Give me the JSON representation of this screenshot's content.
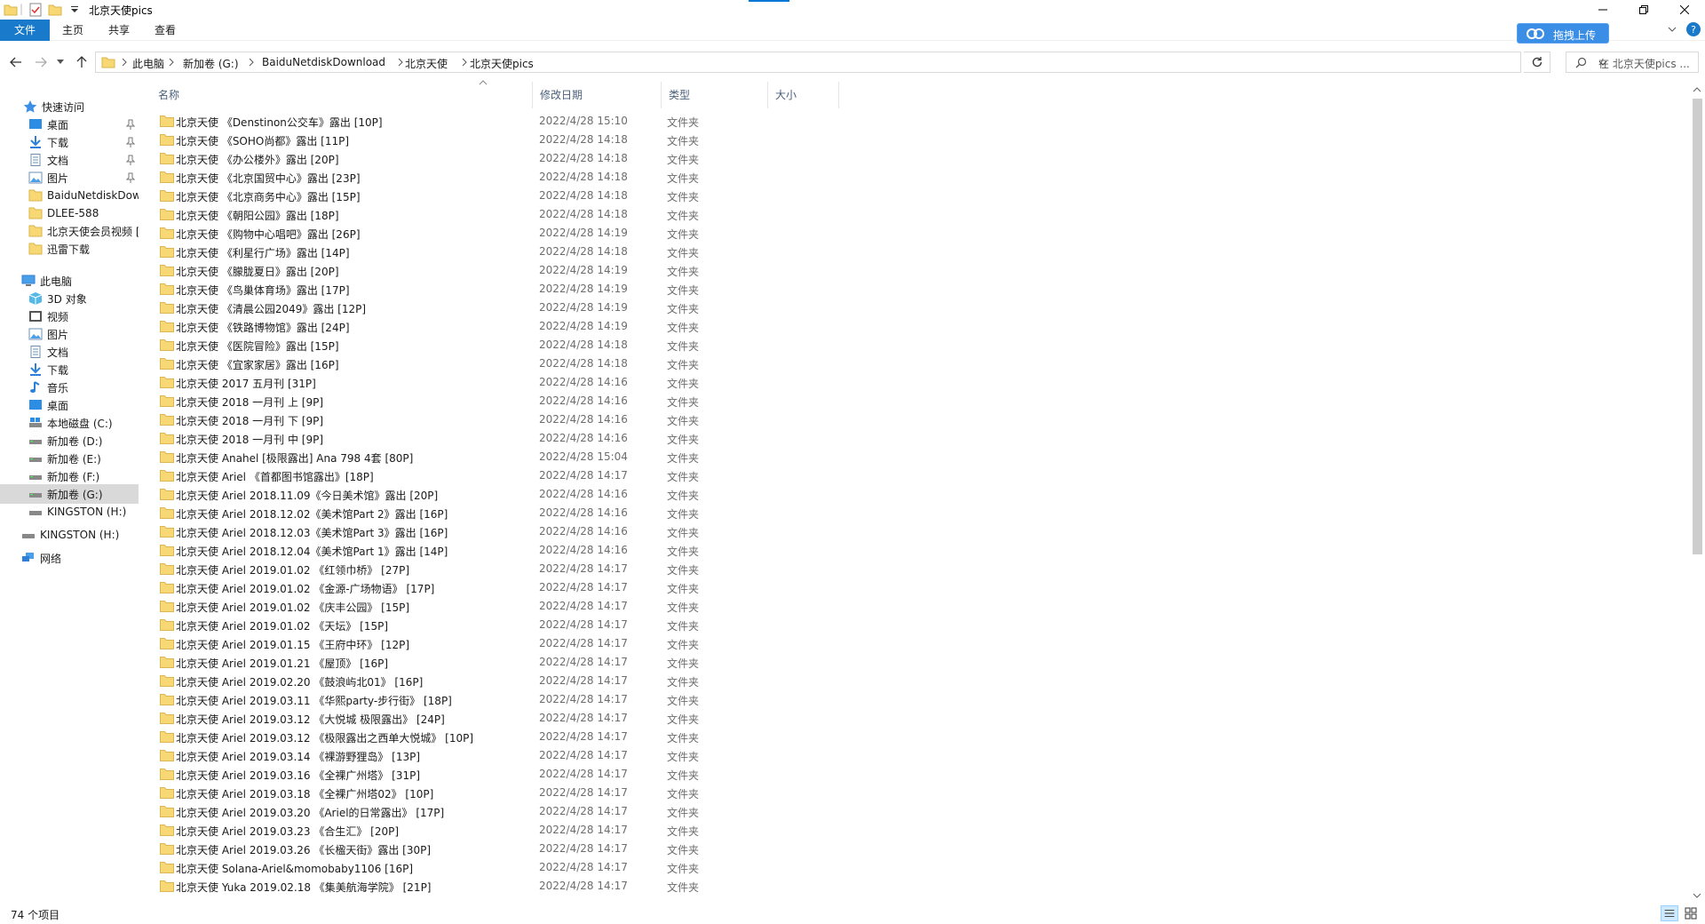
{
  "window": {
    "title": "北京天使pics"
  },
  "ribbon": {
    "tabs": [
      "文件",
      "主页",
      "共享",
      "查看"
    ],
    "upload_label": "拖拽上传"
  },
  "address": {
    "crumbs": [
      "此电脑",
      "新加卷 (G:)",
      "BaiduNetdiskDownload",
      "北京天使",
      "北京天使pics"
    ],
    "search_placeholder": "在 北京天使pics ..."
  },
  "nav": {
    "quick_access": "快速访问",
    "quick_items": [
      "桌面",
      "下载",
      "文档",
      "图片",
      "BaiduNetdiskDow",
      "DLEE-588",
      "北京天使会员视频 [",
      "迅雷下载"
    ],
    "this_pc": "此电脑",
    "pc_items": [
      "3D 对象",
      "视频",
      "图片",
      "文档",
      "下载",
      "音乐",
      "桌面",
      "本地磁盘 (C:)",
      "新加卷 (D:)",
      "新加卷 (E:)",
      "新加卷 (F:)",
      "新加卷 (G:)",
      "KINGSTON (H:)"
    ],
    "kingston": "KINGSTON (H:)",
    "network": "网络"
  },
  "columns": {
    "name": "名称",
    "date": "修改日期",
    "type": "类型",
    "size": "大小"
  },
  "files": [
    {
      "name": "北京天使 《Denstinon公交车》露出 [10P]",
      "date": "2022/4/28 15:10",
      "type": "文件夹"
    },
    {
      "name": "北京天使 《SOHO尚都》露出 [11P]",
      "date": "2022/4/28 14:18",
      "type": "文件夹"
    },
    {
      "name": "北京天使 《办公楼外》露出 [20P]",
      "date": "2022/4/28 14:18",
      "type": "文件夹"
    },
    {
      "name": "北京天使 《北京国贸中心》露出 [23P]",
      "date": "2022/4/28 14:18",
      "type": "文件夹"
    },
    {
      "name": "北京天使 《北京商务中心》露出 [15P]",
      "date": "2022/4/28 14:18",
      "type": "文件夹"
    },
    {
      "name": "北京天使 《朝阳公园》露出 [18P]",
      "date": "2022/4/28 14:18",
      "type": "文件夹"
    },
    {
      "name": "北京天使 《购物中心唱吧》露出 [26P]",
      "date": "2022/4/28 14:19",
      "type": "文件夹"
    },
    {
      "name": "北京天使 《利星行广场》露出 [14P]",
      "date": "2022/4/28 14:18",
      "type": "文件夹"
    },
    {
      "name": "北京天使 《朦胧夏日》露出 [20P]",
      "date": "2022/4/28 14:19",
      "type": "文件夹"
    },
    {
      "name": "北京天使 《鸟巢体育场》露出 [17P]",
      "date": "2022/4/28 14:19",
      "type": "文件夹"
    },
    {
      "name": "北京天使 《清晨公园2049》露出 [12P]",
      "date": "2022/4/28 14:19",
      "type": "文件夹"
    },
    {
      "name": "北京天使 《铁路博物馆》露出 [24P]",
      "date": "2022/4/28 14:19",
      "type": "文件夹"
    },
    {
      "name": "北京天使 《医院冒险》露出 [15P]",
      "date": "2022/4/28 14:18",
      "type": "文件夹"
    },
    {
      "name": "北京天使 《宜家家居》露出 [16P]",
      "date": "2022/4/28 14:18",
      "type": "文件夹"
    },
    {
      "name": "北京天使 2017 五月刊 [31P]",
      "date": "2022/4/28 14:16",
      "type": "文件夹"
    },
    {
      "name": "北京天使 2018 一月刊 上 [9P]",
      "date": "2022/4/28 14:16",
      "type": "文件夹"
    },
    {
      "name": "北京天使 2018 一月刊 下 [9P]",
      "date": "2022/4/28 14:16",
      "type": "文件夹"
    },
    {
      "name": "北京天使 2018 一月刊 中 [9P]",
      "date": "2022/4/28 14:16",
      "type": "文件夹"
    },
    {
      "name": "北京天使 Anahel [极限露出] Ana 798 4套 [80P]",
      "date": "2022/4/28 15:04",
      "type": "文件夹"
    },
    {
      "name": "北京天使 Ariel 《首都图书馆露出》[18P]",
      "date": "2022/4/28 14:17",
      "type": "文件夹"
    },
    {
      "name": "北京天使 Ariel 2018.11.09《今日美术馆》露出 [20P]",
      "date": "2022/4/28 14:16",
      "type": "文件夹"
    },
    {
      "name": "北京天使 Ariel 2018.12.02《美术馆Part 2》露出 [16P]",
      "date": "2022/4/28 14:16",
      "type": "文件夹"
    },
    {
      "name": "北京天使 Ariel 2018.12.03《美术馆Part 3》露出 [16P]",
      "date": "2022/4/28 14:16",
      "type": "文件夹"
    },
    {
      "name": "北京天使 Ariel 2018.12.04《美术馆Part 1》露出 [14P]",
      "date": "2022/4/28 14:16",
      "type": "文件夹"
    },
    {
      "name": "北京天使 Ariel 2019.01.02 《红领巾桥》 [27P]",
      "date": "2022/4/28 14:17",
      "type": "文件夹"
    },
    {
      "name": "北京天使 Ariel 2019.01.02 《金源-广场物语》 [17P]",
      "date": "2022/4/28 14:17",
      "type": "文件夹"
    },
    {
      "name": "北京天使 Ariel 2019.01.02 《庆丰公园》 [15P]",
      "date": "2022/4/28 14:17",
      "type": "文件夹"
    },
    {
      "name": "北京天使 Ariel 2019.01.02 《天坛》 [15P]",
      "date": "2022/4/28 14:17",
      "type": "文件夹"
    },
    {
      "name": "北京天使 Ariel 2019.01.15 《王府中环》 [12P]",
      "date": "2022/4/28 14:17",
      "type": "文件夹"
    },
    {
      "name": "北京天使 Ariel 2019.01.21 《屋顶》 [16P]",
      "date": "2022/4/28 14:17",
      "type": "文件夹"
    },
    {
      "name": "北京天使 Ariel 2019.02.20 《鼓浪屿北01》 [16P]",
      "date": "2022/4/28 14:17",
      "type": "文件夹"
    },
    {
      "name": "北京天使 Ariel 2019.03.11 《华熙party-步行街》 [18P]",
      "date": "2022/4/28 14:17",
      "type": "文件夹"
    },
    {
      "name": "北京天使 Ariel 2019.03.12 《大悦城 极限露出》 [24P]",
      "date": "2022/4/28 14:17",
      "type": "文件夹"
    },
    {
      "name": "北京天使 Ariel 2019.03.12 《极限露出之西单大悦城》 [10P]",
      "date": "2022/4/28 14:17",
      "type": "文件夹"
    },
    {
      "name": "北京天使 Ariel 2019.03.14 《裸游野狸岛》 [13P]",
      "date": "2022/4/28 14:17",
      "type": "文件夹"
    },
    {
      "name": "北京天使 Ariel 2019.03.16 《全裸广州塔》 [31P]",
      "date": "2022/4/28 14:17",
      "type": "文件夹"
    },
    {
      "name": "北京天使 Ariel 2019.03.18 《全裸广州塔02》 [10P]",
      "date": "2022/4/28 14:17",
      "type": "文件夹"
    },
    {
      "name": "北京天使 Ariel 2019.03.20 《Ariel的日常露出》 [17P]",
      "date": "2022/4/28 14:17",
      "type": "文件夹"
    },
    {
      "name": "北京天使 Ariel 2019.03.23 《合生汇》 [20P]",
      "date": "2022/4/28 14:17",
      "type": "文件夹"
    },
    {
      "name": "北京天使 Ariel 2019.03.26 《长楹天街》露出 [30P]",
      "date": "2022/4/28 14:17",
      "type": "文件夹"
    },
    {
      "name": "北京天使 Solana-Ariel&momobaby1106 [16P]",
      "date": "2022/4/28 14:17",
      "type": "文件夹"
    },
    {
      "name": "北京天使 Yuka 2019.02.18 《集美航海学院》 [21P]",
      "date": "2022/4/28 14:17",
      "type": "文件夹"
    }
  ],
  "status": {
    "count": "74 个项目"
  },
  "colors": {
    "accent": "#0078d7",
    "file_tab": "#1979ca",
    "folder": "#f8d775",
    "selection": "#d9d9d9"
  }
}
